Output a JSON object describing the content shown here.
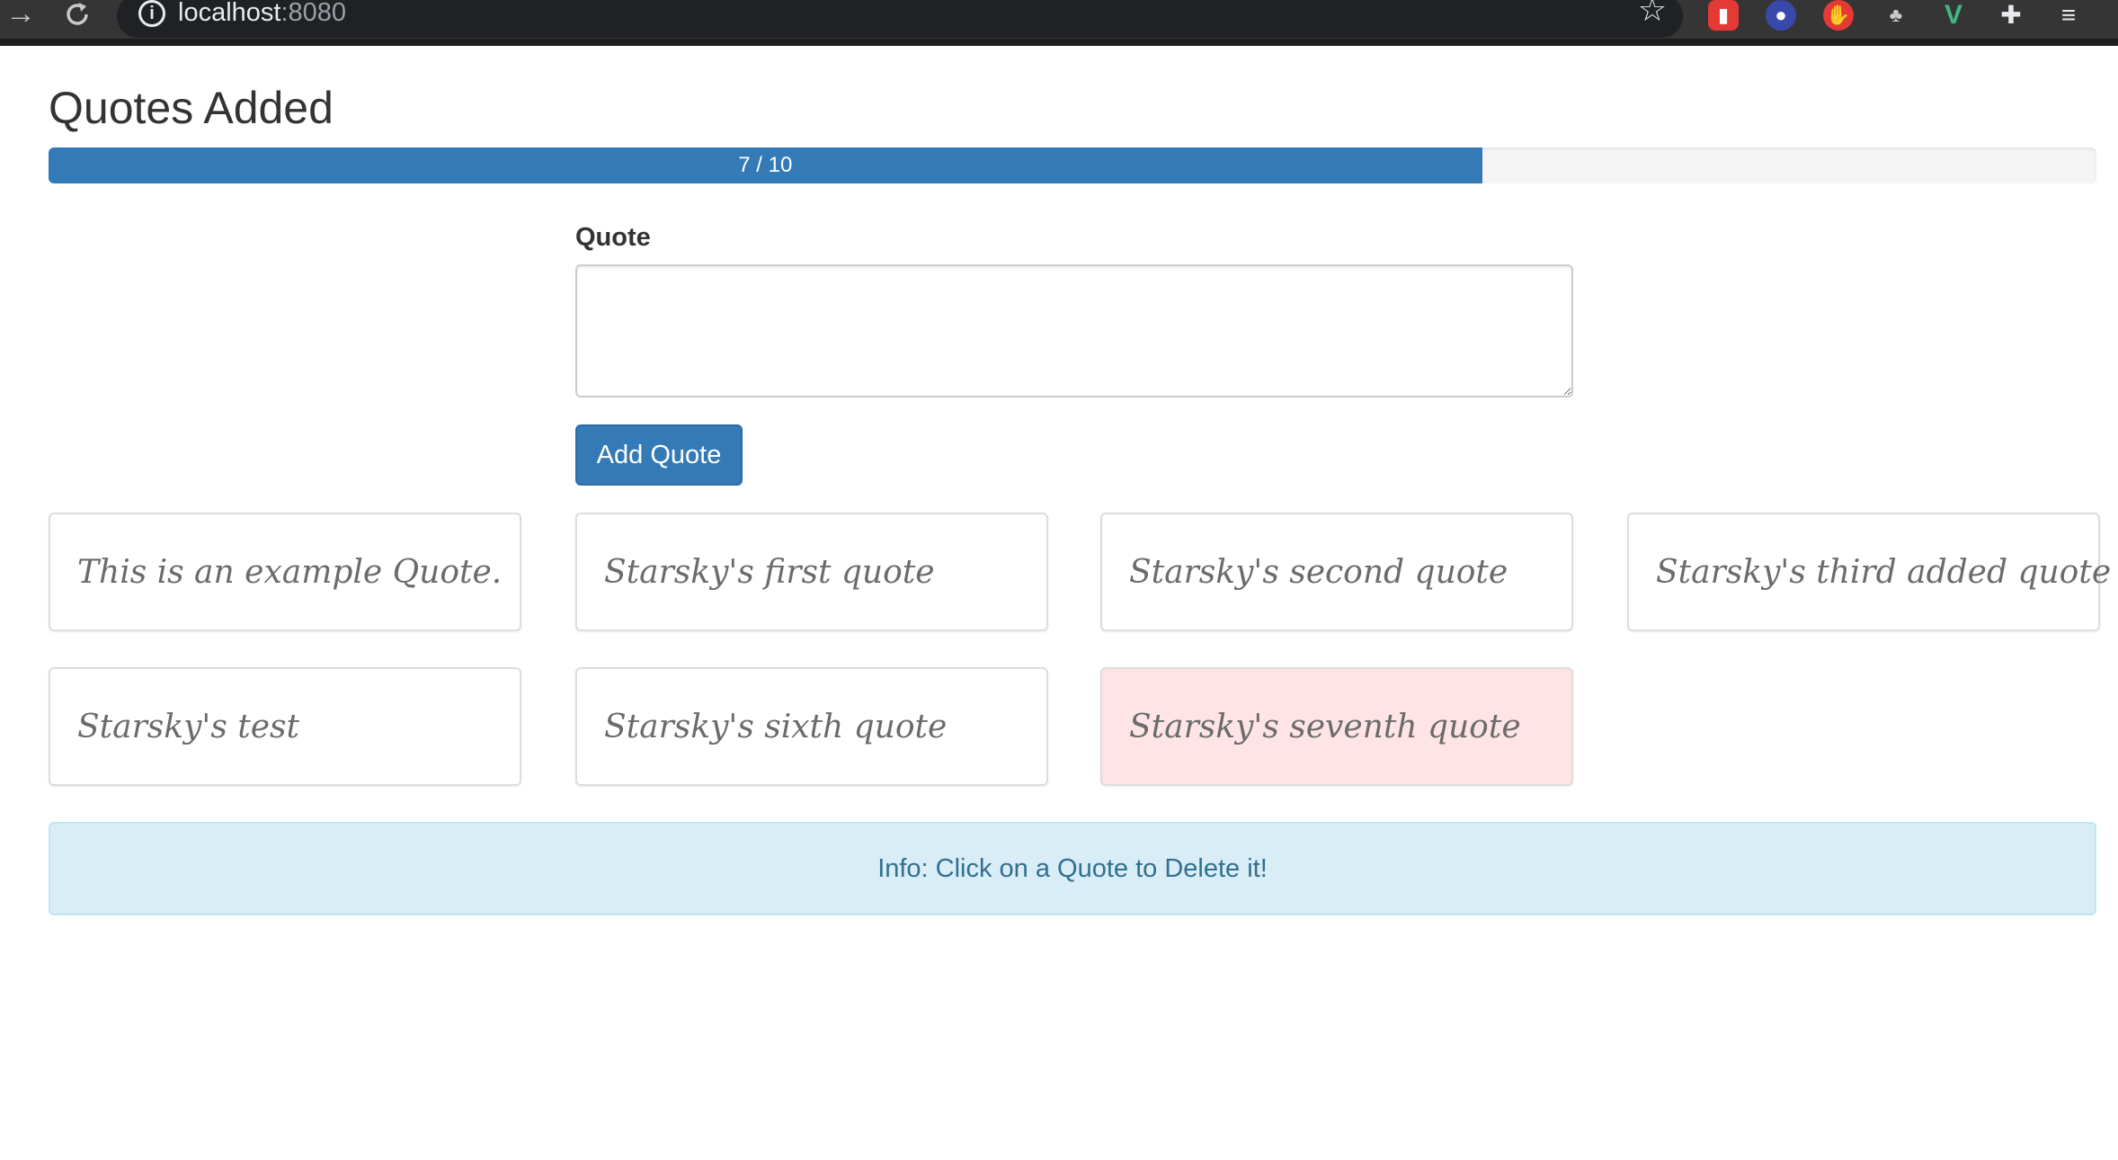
{
  "browser": {
    "url_host": "localhost",
    "url_port": ":8080"
  },
  "page": {
    "title": "Quotes Added"
  },
  "progress": {
    "label": "7 / 10",
    "current": 7,
    "max": 10,
    "fraction": 0.7,
    "color": "#337ab7"
  },
  "form": {
    "label": "Quote",
    "textarea_value": "",
    "button_label": "Add Quote"
  },
  "quotes": [
    {
      "text": "This is an example Quote."
    },
    {
      "text": "Starsky's first quote"
    },
    {
      "text": "Starsky's second quote"
    },
    {
      "text": "Starsky's third added quote"
    },
    {
      "text": "Starsky's test"
    },
    {
      "text": "Starsky's sixth quote"
    },
    {
      "text": "Starsky's seventh quote",
      "highlighted": true
    }
  ],
  "info": {
    "text": "Info: Click on a Quote to Delete it!"
  },
  "colors": {
    "primary": "#337ab7",
    "info_bg": "#d9edf7",
    "info_text": "#31708f",
    "hover_card_bg": "#ffe4e6"
  },
  "icons": {
    "back": "arrow-right-icon",
    "reload": "reload-icon",
    "site_info": "info-icon",
    "bookmark": "star-icon",
    "extensions": "puzzle-icon"
  }
}
